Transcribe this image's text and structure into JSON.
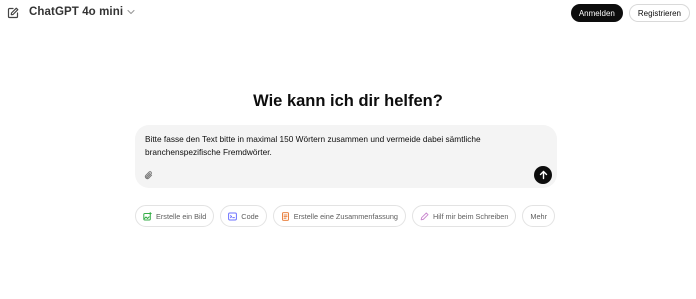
{
  "header": {
    "model_name": "ChatGPT 4o mini",
    "login_label": "Anmelden",
    "register_label": "Registrieren"
  },
  "main": {
    "headline": "Wie kann ich dir helfen?",
    "composer_text": "Bitte fasse den Text bitte in maximal 150 Wörtern zusammen und vermeide dabei sämtliche branchenspezifische Fremdwörter."
  },
  "suggestions": [
    {
      "label": "Erstelle ein Bild",
      "icon": "image-create-icon",
      "color": "#35ae47"
    },
    {
      "label": "Code",
      "icon": "code-icon",
      "color": "#6c71ff"
    },
    {
      "label": "Erstelle eine Zusammenfassung",
      "icon": "document-summary-icon",
      "color": "#ea8444"
    },
    {
      "label": "Hilf mir beim Schreiben",
      "icon": "pen-write-icon",
      "color": "#cb8bd0"
    },
    {
      "label": "Mehr"
    }
  ],
  "colors": {
    "primary_button": "#0d0d0d",
    "composer_bg": "#f4f4f4"
  }
}
